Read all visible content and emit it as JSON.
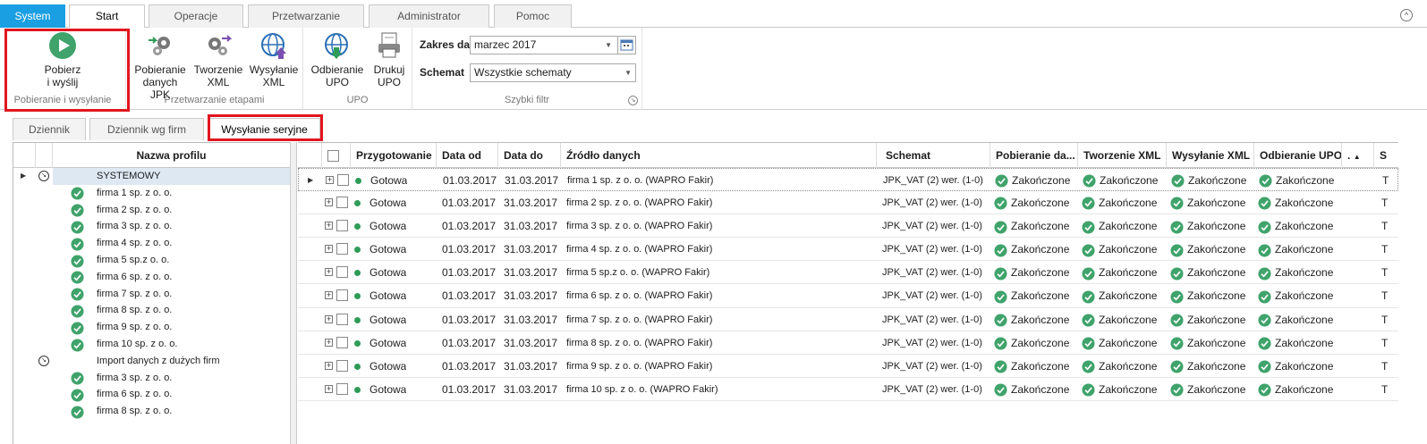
{
  "ribbon_tabs": [
    "System",
    "Start",
    "Operacje",
    "Przetwarzanie",
    "Administrator",
    "Pomoc"
  ],
  "ribbon": {
    "groups": {
      "g1": "Pobieranie i wysyłanie",
      "g2": "Przetwarzanie etapami",
      "g3": "UPO",
      "g4": "Szybki filtr"
    },
    "buttons": {
      "pobierz": [
        "Pobierz",
        "i wyślij"
      ],
      "pobieranie": [
        "Pobieranie",
        "danych JPK"
      ],
      "tworzenie": [
        "Tworzenie",
        "XML"
      ],
      "wysylanie": [
        "Wysyłanie",
        "XML"
      ],
      "odbieranie": [
        "Odbieranie",
        "UPO"
      ],
      "drukuj": [
        "Drukuj",
        "UPO"
      ]
    },
    "filter": {
      "zakres_label": "Zakres dat",
      "zakres_value": "marzec 2017",
      "schemat_label": "Schemat",
      "schemat_value": "Wszystkie schematy"
    }
  },
  "view_tabs": [
    "Dziennik",
    "Dziennik wg firm",
    "Wysyłanie seryjne"
  ],
  "profiles": {
    "header": "Nazwa profilu",
    "items": [
      {
        "kind": "group",
        "label": "SYSTEMOWY"
      },
      {
        "kind": "item",
        "label": "firma 1 sp. z o. o."
      },
      {
        "kind": "item",
        "label": "firma 2 sp. z o. o."
      },
      {
        "kind": "item",
        "label": "firma 3 sp. z o. o."
      },
      {
        "kind": "item",
        "label": "firma 4 sp. z o. o."
      },
      {
        "kind": "item",
        "label": "firma 5 sp.z o. o."
      },
      {
        "kind": "item",
        "label": "firma 6 sp. z o. o."
      },
      {
        "kind": "item",
        "label": "firma 7 sp. z o. o."
      },
      {
        "kind": "item",
        "label": "firma 8 sp. z o. o."
      },
      {
        "kind": "item",
        "label": "firma 9 sp. z o. o."
      },
      {
        "kind": "item",
        "label": "firma 10 sp. z o. o."
      },
      {
        "kind": "group",
        "label": "Import danych z dużych firm"
      },
      {
        "kind": "item",
        "label": "firma 3 sp. z o. o."
      },
      {
        "kind": "item",
        "label": "firma 6 sp. z o. o."
      },
      {
        "kind": "item",
        "label": "firma 8 sp. z o. o."
      }
    ]
  },
  "grid": {
    "columns": [
      "Przygotowanie",
      "Data od",
      "Data do",
      "Źródło danych",
      "Schemat",
      "Pobieranie da...",
      "Tworzenie XML",
      "Wysyłanie XML",
      "Odbieranie UPO",
      ".",
      "S"
    ],
    "rows": [
      {
        "status": "Gotowa",
        "od": "01.03.2017",
        "do": "31.03.2017",
        "zrodlo": "firma 1 sp. z o. o. (WAPRO Fakir)",
        "schemat": "JPK_VAT (2) wer. (1-0)",
        "p": "Zakończone",
        "t": "Zakończone",
        "w": "Zakończone",
        "o": "Zakończone",
        "s": "T"
      },
      {
        "status": "Gotowa",
        "od": "01.03.2017",
        "do": "31.03.2017",
        "zrodlo": "firma 2 sp. z o. o. (WAPRO Fakir)",
        "schemat": "JPK_VAT (2) wer. (1-0)",
        "p": "Zakończone",
        "t": "Zakończone",
        "w": "Zakończone",
        "o": "Zakończone",
        "s": "T"
      },
      {
        "status": "Gotowa",
        "od": "01.03.2017",
        "do": "31.03.2017",
        "zrodlo": "firma 3 sp. z o. o. (WAPRO Fakir)",
        "schemat": "JPK_VAT (2) wer. (1-0)",
        "p": "Zakończone",
        "t": "Zakończone",
        "w": "Zakończone",
        "o": "Zakończone",
        "s": "T"
      },
      {
        "status": "Gotowa",
        "od": "01.03.2017",
        "do": "31.03.2017",
        "zrodlo": "firma 4 sp. z o. o. (WAPRO Fakir)",
        "schemat": "JPK_VAT (2) wer. (1-0)",
        "p": "Zakończone",
        "t": "Zakończone",
        "w": "Zakończone",
        "o": "Zakończone",
        "s": "T"
      },
      {
        "status": "Gotowa",
        "od": "01.03.2017",
        "do": "31.03.2017",
        "zrodlo": "firma 5 sp.z o. o. (WAPRO Fakir)",
        "schemat": "JPK_VAT (2) wer. (1-0)",
        "p": "Zakończone",
        "t": "Zakończone",
        "w": "Zakończone",
        "o": "Zakończone",
        "s": "T"
      },
      {
        "status": "Gotowa",
        "od": "01.03.2017",
        "do": "31.03.2017",
        "zrodlo": "firma 6 sp. z o. o. (WAPRO Fakir)",
        "schemat": "JPK_VAT (2) wer. (1-0)",
        "p": "Zakończone",
        "t": "Zakończone",
        "w": "Zakończone",
        "o": "Zakończone",
        "s": "T"
      },
      {
        "status": "Gotowa",
        "od": "01.03.2017",
        "do": "31.03.2017",
        "zrodlo": "firma 7 sp. z o. o. (WAPRO Fakir)",
        "schemat": "JPK_VAT (2) wer. (1-0)",
        "p": "Zakończone",
        "t": "Zakończone",
        "w": "Zakończone",
        "o": "Zakończone",
        "s": "T"
      },
      {
        "status": "Gotowa",
        "od": "01.03.2017",
        "do": "31.03.2017",
        "zrodlo": "firma 8 sp. z o. o. (WAPRO Fakir)",
        "schemat": "JPK_VAT (2) wer. (1-0)",
        "p": "Zakończone",
        "t": "Zakończone",
        "w": "Zakończone",
        "o": "Zakończone",
        "s": "T"
      },
      {
        "status": "Gotowa",
        "od": "01.03.2017",
        "do": "31.03.2017",
        "zrodlo": "firma 9 sp. z o. o. (WAPRO Fakir)",
        "schemat": "JPK_VAT (2) wer. (1-0)",
        "p": "Zakończone",
        "t": "Zakończone",
        "w": "Zakończone",
        "o": "Zakończone",
        "s": "T"
      },
      {
        "status": "Gotowa",
        "od": "01.03.2017",
        "do": "31.03.2017",
        "zrodlo": "firma 10 sp. z o. o. (WAPRO Fakir)",
        "schemat": "JPK_VAT (2) wer. (1-0)",
        "p": "Zakończone",
        "t": "Zakończone",
        "w": "Zakończone",
        "o": "Zakończone",
        "s": "T"
      }
    ]
  },
  "colors": {
    "accent": "#1b9fe3",
    "highlight": "#e0161f",
    "ok": "#3fa36b",
    "status_dot": "#2e9b57"
  },
  "icons": [
    "play-icon",
    "gears-download-icon",
    "gears-icon",
    "globe-upload-icon",
    "globe-download-icon",
    "print-upo-icon",
    "calendar-icon",
    "chevron-down-icon",
    "check-circle-icon",
    "collapse-ribbon-icon"
  ]
}
